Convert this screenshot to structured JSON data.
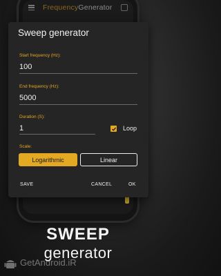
{
  "app_bar": {
    "title_part1": "Frequency",
    "title_part2": "Generator"
  },
  "dialog": {
    "title": "Sweep generator",
    "start": {
      "label": "Start frequency (Hz):",
      "value": "100"
    },
    "end": {
      "label": "End frequency (Hz):",
      "value": "5000"
    },
    "duration": {
      "label": "Duration (S):",
      "value": "1"
    },
    "loop": {
      "label": "Loop",
      "checked": true
    },
    "scale": {
      "label": "Scale:",
      "options": [
        "Logarithmic",
        "Linear"
      ],
      "selected": "Logarithmic"
    },
    "actions": {
      "save": "SAVE",
      "cancel": "CANCEL",
      "ok": "OK"
    }
  },
  "headline": {
    "line1": "SWEEP",
    "line2": "generator"
  },
  "watermark": "GetAndroid.iR",
  "colors": {
    "accent": "#e3a923",
    "dialog_bg": "#252525",
    "text": "#f0f0f0"
  }
}
